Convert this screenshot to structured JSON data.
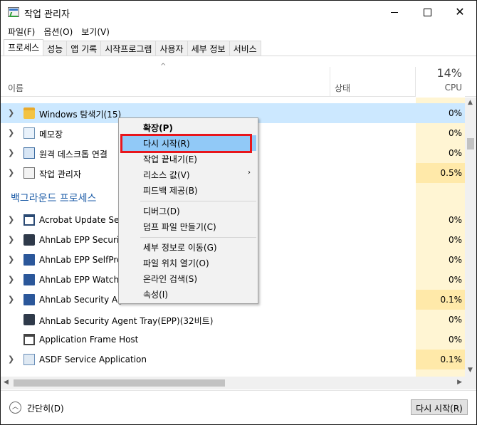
{
  "window": {
    "title": "작업 관리자"
  },
  "menu": [
    "파일(F)",
    "옵션(O)",
    "보기(V)"
  ],
  "tabs": [
    "프로세스",
    "성능",
    "앱 기록",
    "시작프로그램",
    "사용자",
    "세부 정보",
    "서비스"
  ],
  "active_tab": "프로세스",
  "header": {
    "sort_arrow": "^",
    "name": "이름",
    "status": "상태",
    "cpu_total": "14%",
    "cpu_label": "CPU"
  },
  "apps": [
    {
      "name": "Windows 탐색기(15)",
      "cpu": "0%",
      "icon": "folder-icon"
    },
    {
      "name": "메모장",
      "cpu": "0%",
      "icon": "notepad-icon"
    },
    {
      "name": "원격 데스크톱 연결",
      "cpu": "0%",
      "icon": "remote-desktop-icon"
    },
    {
      "name": "작업 관리자",
      "cpu": "0.5%",
      "icon": "task-manager-icon"
    }
  ],
  "background_group": "백그라운드 프로세스",
  "background": [
    {
      "name": "Acrobat Update Serv",
      "cpu": "0%",
      "icon": "window-icon"
    },
    {
      "name": "AhnLab EPP Security",
      "cpu": "0%",
      "icon": "ahnlab-icon"
    },
    {
      "name": "AhnLab EPP SelfProt",
      "cpu": "0%",
      "icon": "service-icon"
    },
    {
      "name": "AhnLab EPP WatchD",
      "cpu": "0%",
      "icon": "service-icon"
    },
    {
      "name": "AhnLab Security Age",
      "cpu": "0.1%",
      "icon": "service-icon"
    },
    {
      "name": "AhnLab Security Agent Tray(EPP)(32비트)",
      "cpu": "0%",
      "icon": "ahnlab-icon"
    },
    {
      "name": "Application Frame Host",
      "cpu": "0%",
      "icon": "app-frame-icon"
    },
    {
      "name": "ASDF Service Application",
      "cpu": "0.1%",
      "icon": "asdf-icon"
    }
  ],
  "context_menu": {
    "expand": "확장(P)",
    "restart": "다시 시작(R)",
    "end_task": "작업 끝내기(E)",
    "resource_values": "리소스 값(V)",
    "feedback": "피드백 제공(B)",
    "debug": "디버그(D)",
    "dump": "덤프 파일 만들기(C)",
    "go_details": "세부 정보로 이동(G)",
    "open_location": "파일 위치 열기(O)",
    "search_online": "온라인 검색(S)",
    "properties": "속성(I)",
    "submenu_arrow": "›"
  },
  "footer": {
    "fewer_details": "간단히(D)",
    "restart_button": "다시 시작(R)"
  },
  "colors": {
    "selected_row": "#cce8ff",
    "cpu_column": "#fff5d3",
    "highlight_box": "#e8161c",
    "group_header": "#1f5ea8"
  }
}
